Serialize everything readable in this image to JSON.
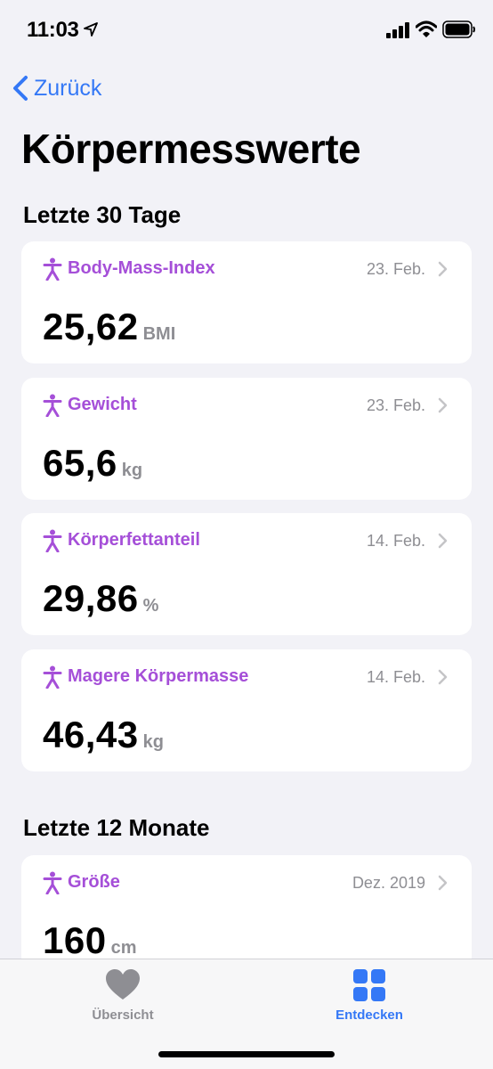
{
  "status_bar": {
    "time": "11:03",
    "icons": [
      "location-arrow-icon",
      "cellular-signal-icon",
      "wifi-icon",
      "battery-icon"
    ]
  },
  "nav": {
    "back_label": "Zurück"
  },
  "title": "Körpermesswerte",
  "colors": {
    "accent": "#3478f6",
    "category": "#a54fd8",
    "secondary_text": "#8e8e93",
    "background": "#f2f2f7"
  },
  "sections": [
    {
      "header": "Letzte 30 Tage",
      "cards": [
        {
          "title": "Body-Mass-Index",
          "date": "23. Feb.",
          "value": "25,62",
          "unit": "BMI"
        },
        {
          "title": "Gewicht",
          "date": "23. Feb.",
          "value": "65,6",
          "unit": "kg"
        },
        {
          "title": "Körperfettanteil",
          "date": "14. Feb.",
          "value": "29,86",
          "unit": "%"
        },
        {
          "title": "Magere Körpermasse",
          "date": "14. Feb.",
          "value": "46,43",
          "unit": "kg"
        }
      ]
    },
    {
      "header": "Letzte 12 Monate",
      "cards": [
        {
          "title": "Größe",
          "date": "Dez. 2019",
          "value": "160",
          "unit": "cm"
        }
      ]
    }
  ],
  "tab_bar": {
    "tabs": [
      {
        "label": "Übersicht",
        "icon": "heart-icon",
        "selected": false
      },
      {
        "label": "Entdecken",
        "icon": "grid-icon",
        "selected": true
      }
    ]
  }
}
